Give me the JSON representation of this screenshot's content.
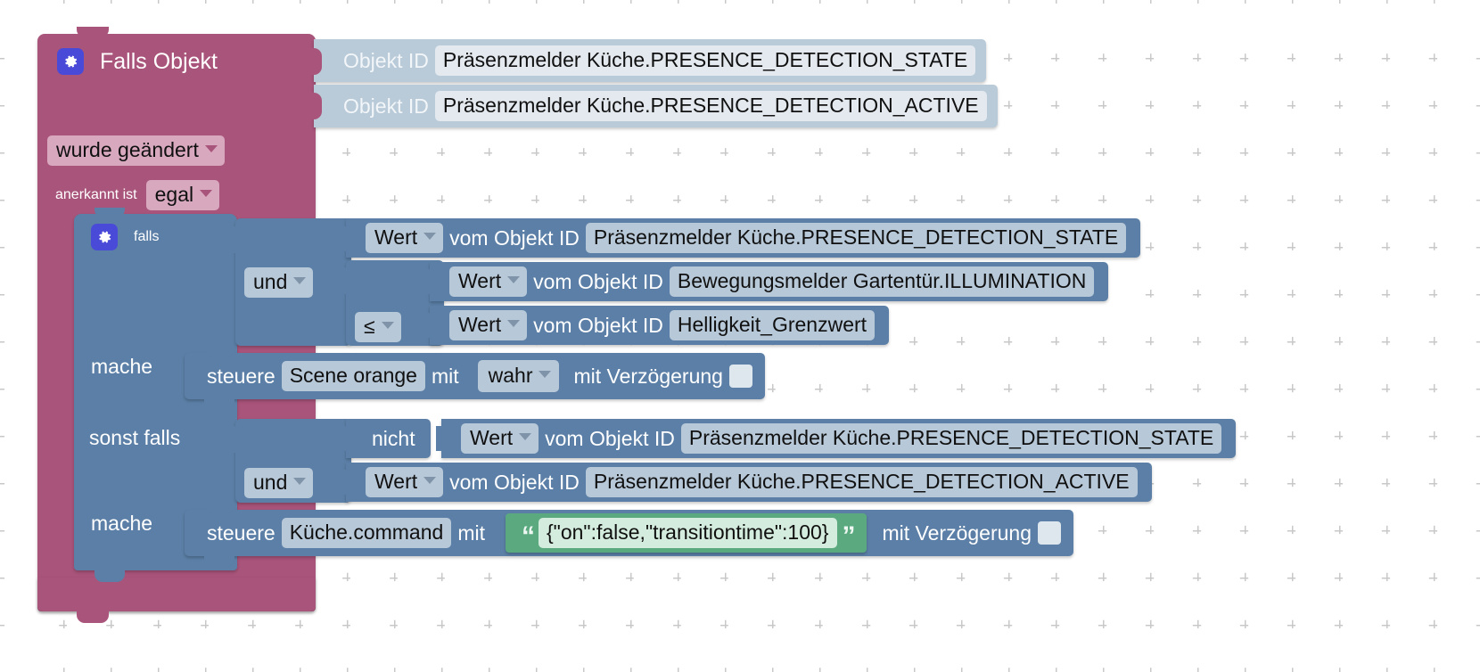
{
  "workspace": {
    "kind": "blockly-visual-script",
    "background_color": "#ffffff",
    "grid_color": "#c8c8c8"
  },
  "palette": {
    "trigger_block": "#a9547a",
    "logic_block": "#5b7fa6",
    "objectid_block": "#b9cad8",
    "string_block": "#5aa97f",
    "field_light": "#e3e9ef",
    "mutator_icon": "#4a4ad8"
  },
  "trigger": {
    "title": "Falls Objekt",
    "gear_icon": "gear-icon",
    "object_id_label_1": "Objekt ID",
    "object_id_value_1": "Präsenzmelder Küche.PRESENCE_DETECTION_STATE",
    "object_id_label_2": "Objekt ID",
    "object_id_value_2": "Präsenzmelder Küche.PRESENCE_DETECTION_ACTIVE",
    "change_mode": "wurde geändert",
    "ack_label": "anerkannt ist",
    "ack_value": "egal"
  },
  "controls_if": {
    "gear_icon": "gear-icon",
    "if_label": "falls",
    "condition_1": {
      "value_label": "Wert",
      "from_label": "vom Objekt ID",
      "object_id": "Präsenzmelder Küche.PRESENCE_DETECTION_STATE"
    },
    "logic_operator": "und",
    "condition_2": {
      "value_label": "Wert",
      "from_label": "vom Objekt ID",
      "object_id": "Bewegungsmelder Gartentür.ILLUMINATION"
    },
    "compare_operator": "≤",
    "condition_3": {
      "value_label": "Wert",
      "from_label": "vom Objekt ID",
      "object_id": "Helligkeit_Grenzwert"
    },
    "do_label": "mache",
    "action_1": {
      "control_label": "steuere",
      "target": "Scene orange",
      "with_label": "mit",
      "value": "wahr",
      "delay_label": "mit Verzögerung"
    },
    "else_if_label": "sonst falls",
    "not_label": "nicht",
    "condition_4": {
      "value_label": "Wert",
      "from_label": "vom Objekt ID",
      "object_id": "Präsenzmelder Küche.PRESENCE_DETECTION_STATE"
    },
    "logic_operator_2": "und",
    "condition_5": {
      "value_label": "Wert",
      "from_label": "vom Objekt ID",
      "object_id": "Präsenzmelder Küche.PRESENCE_DETECTION_ACTIVE"
    },
    "do_label_2": "mache",
    "action_2": {
      "control_label": "steuere",
      "target": "Küche.command",
      "with_label": "mit",
      "string_value": "{\"on\":false,\"transitiontime\":100}",
      "quote_open": "“",
      "quote_close": "”",
      "delay_label": "mit Verzögerung"
    }
  }
}
